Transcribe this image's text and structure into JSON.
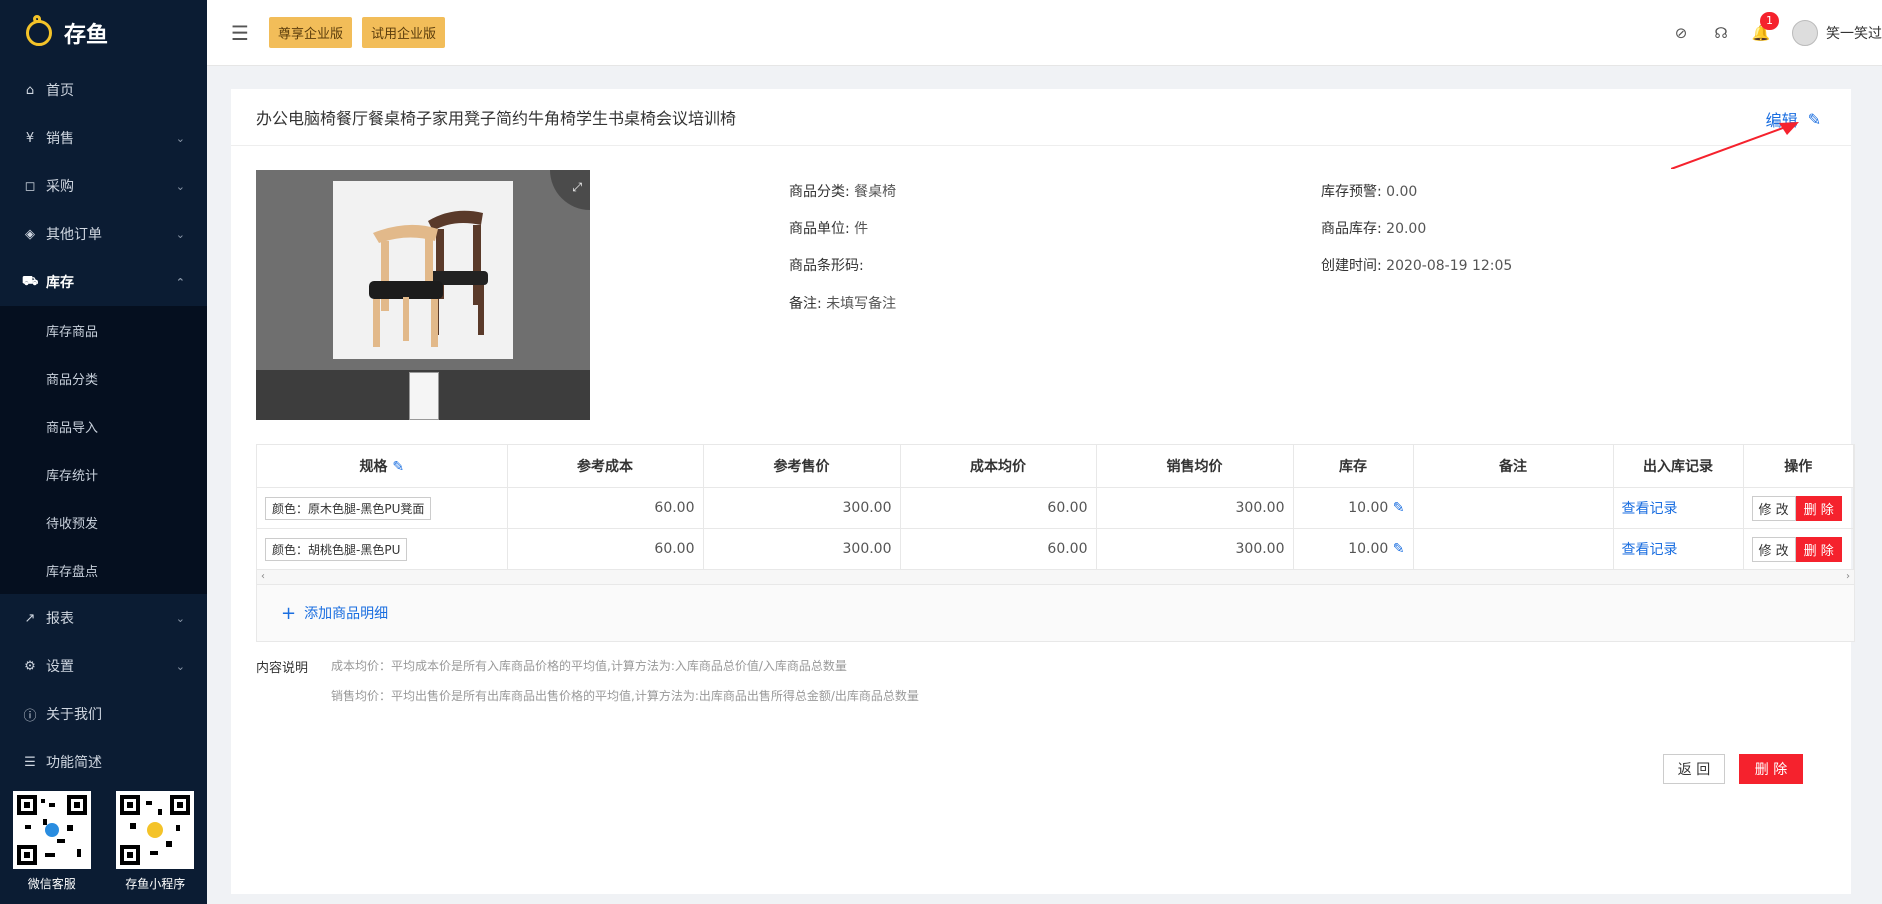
{
  "app": {
    "name": "存鱼"
  },
  "topbar": {
    "plan_btn_1": "尊享企业版",
    "plan_btn_2": "试用企业版",
    "notify_count": "1",
    "username": "笑一笑过"
  },
  "sidebar": {
    "items": [
      {
        "label": "首页",
        "icon": "home-icon"
      },
      {
        "label": "销售",
        "icon": "yen-icon"
      },
      {
        "label": "采购",
        "icon": "bag-icon"
      },
      {
        "label": "其他订单",
        "icon": "tag-icon"
      },
      {
        "label": "库存",
        "icon": "cart-icon"
      },
      {
        "label": "报表",
        "icon": "chart-icon"
      },
      {
        "label": "设置",
        "icon": "gear-icon"
      },
      {
        "label": "关于我们",
        "icon": "info-icon"
      },
      {
        "label": "功能简述",
        "icon": "list-icon"
      }
    ],
    "stock_sub": [
      "库存商品",
      "商品分类",
      "商品导入",
      "库存统计",
      "待收预发",
      "库存盘点"
    ],
    "qr": [
      "微信客服",
      "存鱼小程序"
    ]
  },
  "product": {
    "title": "办公电脑椅餐厅餐桌椅子家用凳子简约牛角椅学生书桌椅会议培训椅",
    "edit": "编辑",
    "fields": {
      "category_label": "商品分类:",
      "category": "餐桌椅",
      "unit_label": "商品单位:",
      "unit": "件",
      "barcode_label": "商品条形码:",
      "barcode": "",
      "remark_label": "备注:",
      "remark": "未填写备注",
      "warn_label": "库存预警:",
      "warn": "0.00",
      "stock_label": "商品库存:",
      "stock": "20.00",
      "created_label": "创建时间:",
      "created": "2020-08-19 12:05"
    }
  },
  "table": {
    "headers": [
      "规格",
      "参考成本",
      "参考售价",
      "成本均价",
      "销售均价",
      "库存",
      "备注",
      "出入库记录",
      "操作"
    ],
    "rows": [
      {
        "spec": "颜色：原木色腿-黑色PU凳面",
        "cost": "60.00",
        "price": "300.00",
        "avg_cost": "60.00",
        "avg_price": "300.00",
        "stock": "10.00",
        "remark": "",
        "record": "查看记录",
        "modify": "修 改",
        "delete": "删 除"
      },
      {
        "spec": "颜色：胡桃色腿-黑色PU",
        "cost": "60.00",
        "price": "300.00",
        "avg_cost": "60.00",
        "avg_price": "300.00",
        "stock": "10.00",
        "remark": "",
        "record": "查看记录",
        "modify": "修 改",
        "delete": "删 除"
      }
    ],
    "add": "添加商品明细"
  },
  "notes": {
    "label": "内容说明",
    "line1": "成本均价：平均成本价是所有入库商品价格的平均值,计算方法为:入库商品总价值/入库商品总数量",
    "line2": "销售均价：平均出售价是所有出库商品出售价格的平均值,计算方法为:出库商品出售所得总金额/出库商品总数量"
  },
  "actions": {
    "back": "返 回",
    "delete": "删 除"
  }
}
